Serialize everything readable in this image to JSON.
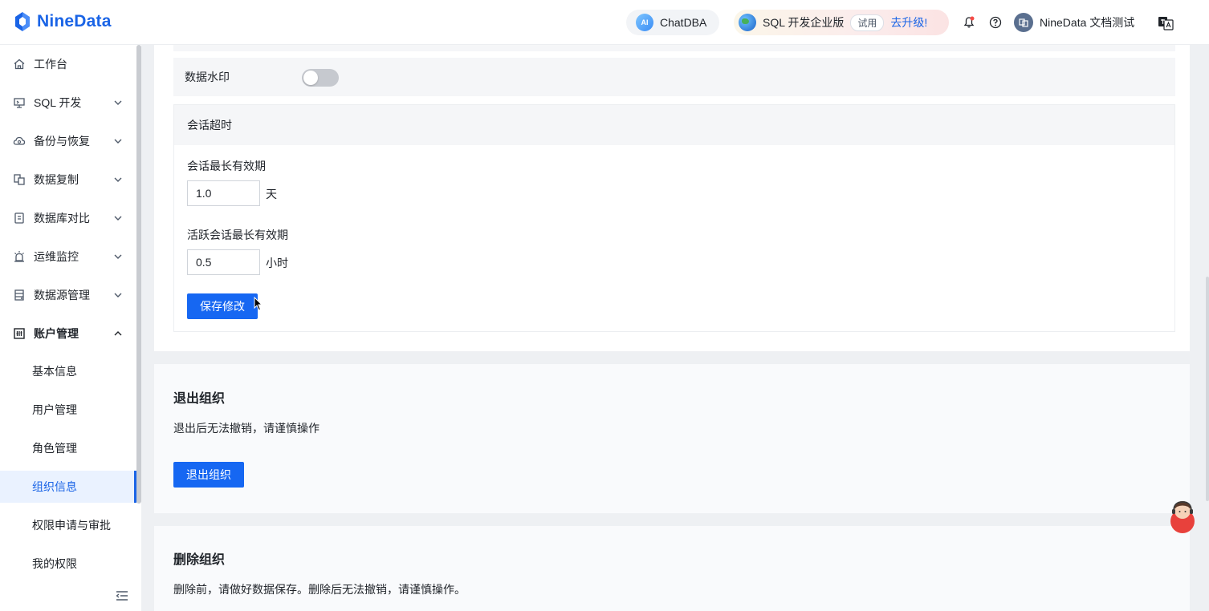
{
  "header": {
    "brand": "NineData",
    "chatdba_label": "ChatDBA",
    "chatdba_badge": "AI",
    "edition_name": "SQL 开发企业版",
    "trial_badge": "试用",
    "upgrade_label": "去升级!",
    "user_name": "NineData 文档测试"
  },
  "sidebar": {
    "items": [
      {
        "label": "工作台",
        "icon": "home-icon"
      },
      {
        "label": "SQL 开发",
        "icon": "monitor-icon"
      },
      {
        "label": "备份与恢复",
        "icon": "cloud-icon"
      },
      {
        "label": "数据复制",
        "icon": "copy-icon"
      },
      {
        "label": "数据库对比",
        "icon": "compare-icon"
      },
      {
        "label": "运维监控",
        "icon": "alarm-icon"
      },
      {
        "label": "数据源管理",
        "icon": "datasource-icon"
      },
      {
        "label": "账户管理",
        "icon": "account-icon"
      }
    ],
    "sub_items": [
      {
        "label": "基本信息"
      },
      {
        "label": "用户管理"
      },
      {
        "label": "角色管理"
      },
      {
        "label": "组织信息",
        "active": true
      },
      {
        "label": "权限申请与审批"
      },
      {
        "label": "我的权限"
      }
    ]
  },
  "settings": {
    "watermark_label": "数据水印",
    "watermark_enabled": false,
    "session_timeout_title": "会话超时",
    "session_max_label": "会话最长有效期",
    "session_max_value": "1.0",
    "session_max_unit": "天",
    "active_session_label": "活跃会话最长有效期",
    "active_session_value": "0.5",
    "active_session_unit": "小时",
    "save_label": "保存修改"
  },
  "leave_org": {
    "title": "退出组织",
    "description": "退出后无法撤销，请谨慎操作",
    "button_label": "退出组织"
  },
  "delete_org": {
    "title": "删除组织",
    "description": "删除前，请做好数据保存。删除后无法撤销，请谨慎操作。"
  },
  "colors": {
    "primary": "#1667f2",
    "brand": "#1a64e6",
    "active_bg": "#eaf2ff"
  }
}
